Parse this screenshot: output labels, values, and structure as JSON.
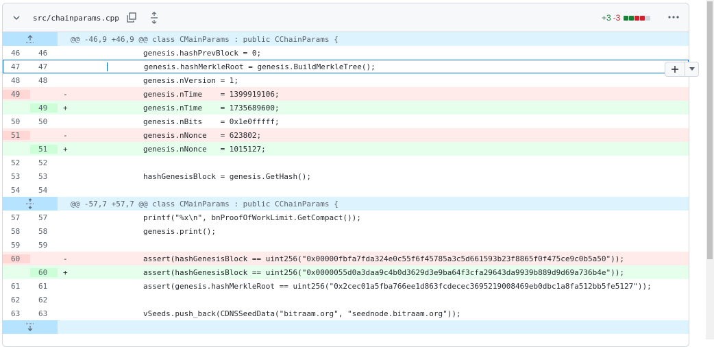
{
  "file": {
    "name": "src/chainparams.cpp",
    "additions": "+3",
    "deletions": "-3",
    "colors": {
      "add": "#1a7f37",
      "del": "#cf222e",
      "neutral": "#d0d7de"
    }
  },
  "icons": [
    "chevron-down-icon",
    "copy-icon",
    "unfold-icon",
    "kebab-horizontal-icon",
    "plus-icon",
    "triangle-down-icon",
    "fold-up-icon",
    "fold-icon"
  ],
  "hunks": [
    "@@ -46,9 +46,9 @@ class CMainParams : public CChainParams {",
    "@@ -57,7 +57,7 @@ class CMainParams : public CChainParams {"
  ],
  "lines": [
    {
      "old": "46",
      "new": "46",
      "sign": "",
      "code": "        genesis.hashPrevBlock = 0;"
    },
    {
      "old": "47",
      "new": "47",
      "sign": "",
      "code": "        genesis.hashMerkleRoot = genesis.BuildMerkleTree();"
    },
    {
      "old": "48",
      "new": "48",
      "sign": "",
      "code": "        genesis.nVersion = 1;"
    },
    {
      "old": "49",
      "new": "",
      "sign": "-",
      "code": "        genesis.nTime    = 1399919106;"
    },
    {
      "old": "",
      "new": "49",
      "sign": "+",
      "code": "        genesis.nTime    = 1735689600;"
    },
    {
      "old": "50",
      "new": "50",
      "sign": "",
      "code": "        genesis.nBits    = 0x1e0fffff;"
    },
    {
      "old": "51",
      "new": "",
      "sign": "-",
      "code": "        genesis.nNonce   = 623802;"
    },
    {
      "old": "",
      "new": "51",
      "sign": "+",
      "code": "        genesis.nNonce   = 1015127;"
    },
    {
      "old": "52",
      "new": "52",
      "sign": "",
      "code": ""
    },
    {
      "old": "53",
      "new": "53",
      "sign": "",
      "code": "        hashGenesisBlock = genesis.GetHash();"
    },
    {
      "old": "54",
      "new": "54",
      "sign": "",
      "code": ""
    },
    {
      "old": "57",
      "new": "57",
      "sign": "",
      "code": "        printf(\"%x\\n\", bnProofOfWorkLimit.GetCompact());"
    },
    {
      "old": "58",
      "new": "58",
      "sign": "",
      "code": "        genesis.print();"
    },
    {
      "old": "59",
      "new": "59",
      "sign": "",
      "code": ""
    },
    {
      "old": "60",
      "new": "",
      "sign": "-",
      "code": "        assert(hashGenesisBlock == uint256(\"0x00000fbfa7fda324e0c55f6f45785a3c5d661593b23f8865f0f475ce9c0b5a50\"));"
    },
    {
      "old": "",
      "new": "60",
      "sign": "+",
      "code": "        assert(hashGenesisBlock == uint256(\"0x0000055d0a3daa9c4b0d3629d3e9ba64f3cfa29643da9939b889d9d69a736b4e\"));"
    },
    {
      "old": "61",
      "new": "61",
      "sign": "",
      "code": "        assert(genesis.hashMerkleRoot == uint256(\"0x2cec01a5fba766ee1d863fcdecec3695219008469eb0dbc1a8fa512bb5fe5127\"));"
    },
    {
      "old": "62",
      "new": "62",
      "sign": "",
      "code": ""
    },
    {
      "old": "63",
      "new": "63",
      "sign": "",
      "code": "        vSeeds.push_back(CDNSSeedData(\"bitraam.org\", \"seednode.bitraam.org\"));"
    }
  ]
}
